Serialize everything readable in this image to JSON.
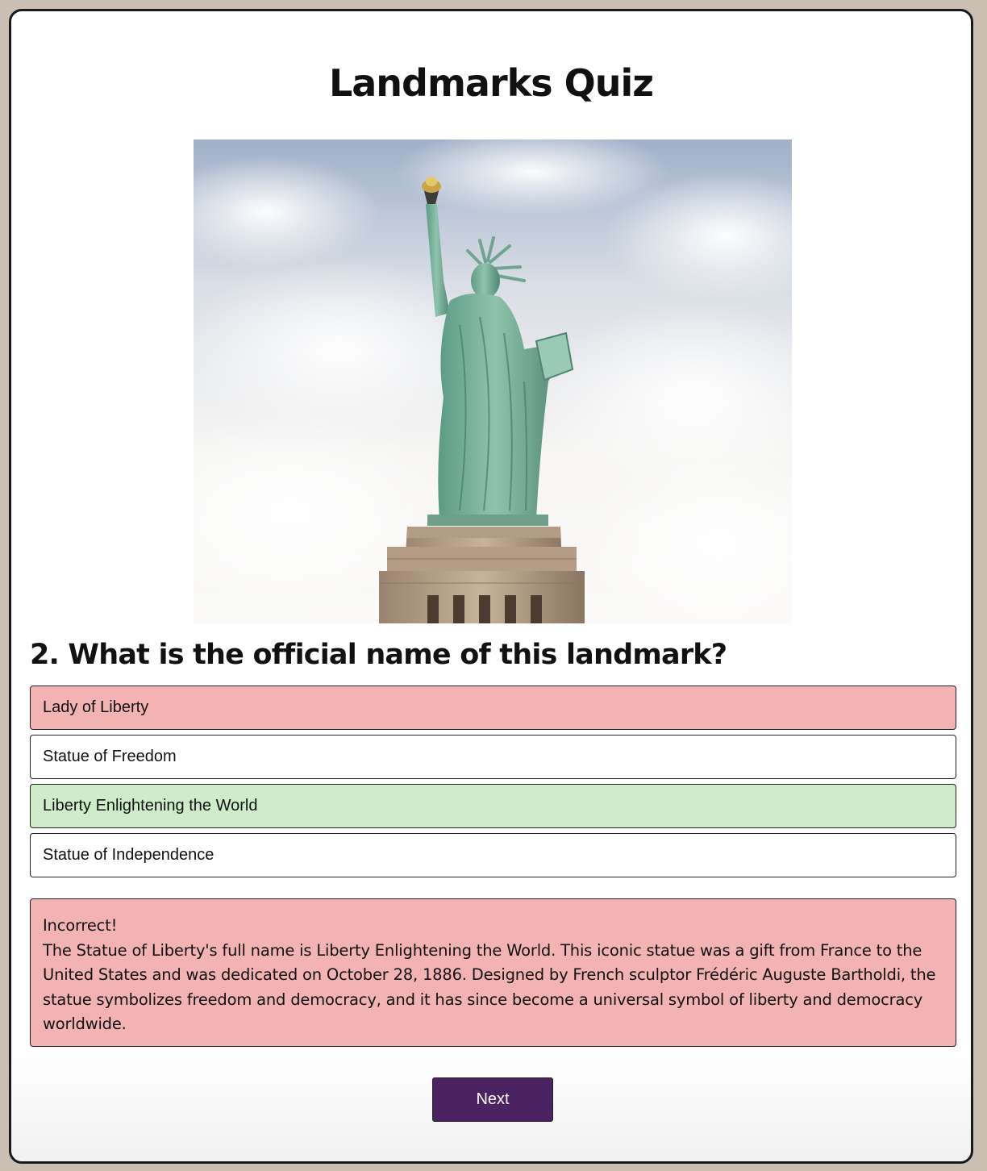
{
  "quiz": {
    "title": "Landmarks Quiz",
    "question": "2. What is the official name of this landmark?",
    "image_subject": "statue-of-liberty-photo",
    "options": [
      {
        "label": "Lady of Liberty",
        "state": "selected-incorrect"
      },
      {
        "label": "Statue of Freedom",
        "state": "default"
      },
      {
        "label": "Liberty Enlightening the World",
        "state": "correct"
      },
      {
        "label": "Statue of Independence",
        "state": "default"
      }
    ],
    "feedback": {
      "status": "Incorrect!",
      "explanation": "The Statue of Liberty's full name is Liberty Enlightening the World. This iconic statue was a gift from France to the United States and was dedicated on October 28, 1886. Designed by French sculptor Frédéric Auguste Bartholdi, the statue symbolizes freedom and democracy, and it has since become a universal symbol of liberty and democracy worldwide."
    },
    "next_label": "Next"
  },
  "colors": {
    "page_background": "#cbbfb4",
    "incorrect": "#f4b3b3",
    "correct": "#cfecc9",
    "next_button": "#4b2362"
  }
}
